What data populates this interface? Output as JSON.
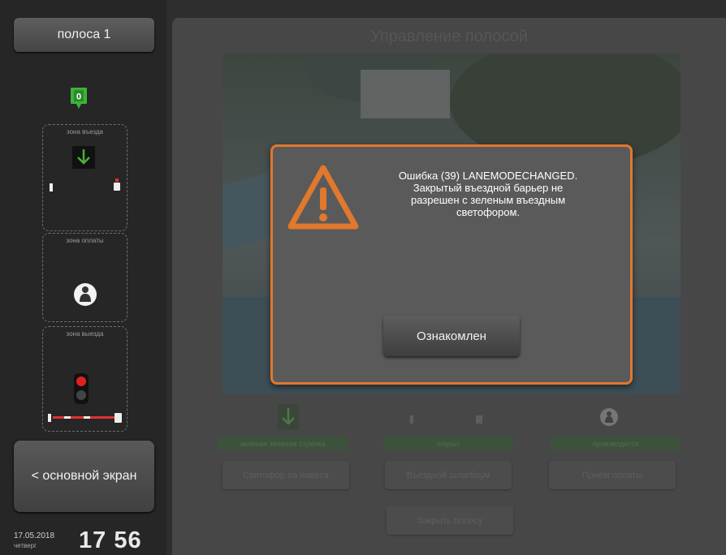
{
  "sidebar": {
    "lane_button": "полоса 1",
    "counter": "0",
    "zones": [
      {
        "label": "зона въезда"
      },
      {
        "label": "зона оплаты"
      },
      {
        "label": "зона выезда"
      }
    ],
    "main_screen_button": "< основной экран",
    "date": "17.05.2018",
    "weekday": "четверг",
    "time": "17 56"
  },
  "main": {
    "title": "Управление полосой",
    "statuses": [
      "зеленая зеленая стрелка",
      "открыт",
      "производится"
    ],
    "buttons": [
      "Светофор на навеса",
      "Въездной шлагбаум",
      "Приём оплаты"
    ],
    "close_lane_button": "Закрыть полосу"
  },
  "modal": {
    "message_lines": [
      "Ошибка (39) LANEMODECHANGED.",
      "Закрытый въездной барьер не",
      "разрешен с зеленым въездным",
      "светофором."
    ],
    "ack_button": "Ознакомлен",
    "icon": "warning-triangle-icon"
  },
  "colors": {
    "accent_orange": "#e0782e",
    "green_signal": "#4caf3a",
    "red_signal": "#e02020"
  }
}
